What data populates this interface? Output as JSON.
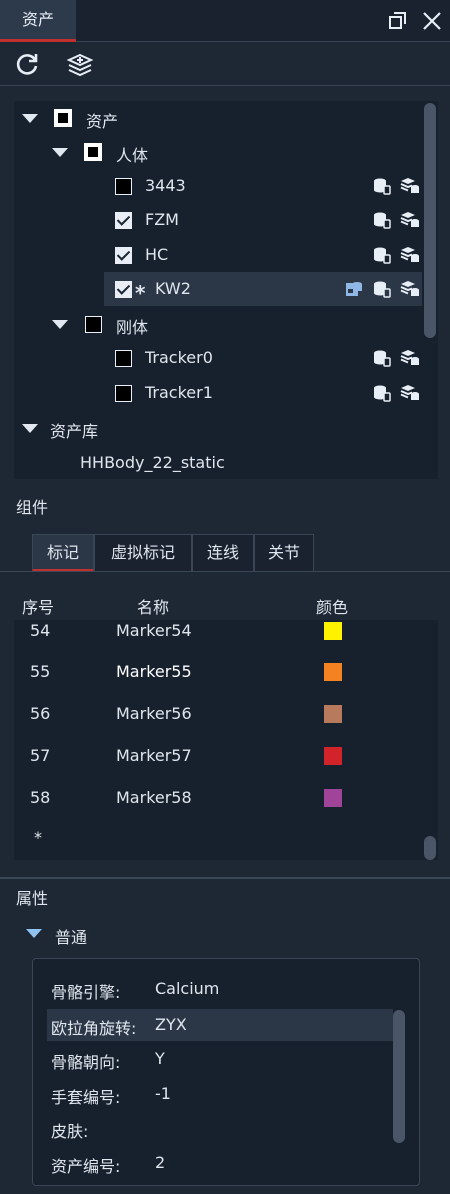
{
  "header": {
    "tab_label": "资产"
  },
  "tree": {
    "root": {
      "label": "资产"
    },
    "group_body": {
      "label": "人体"
    },
    "items": [
      {
        "label": "3443",
        "checked": false
      },
      {
        "label": "FZM",
        "checked": true
      },
      {
        "label": "HC",
        "checked": true
      },
      {
        "label": "KW2",
        "checked": true,
        "selected": true,
        "marker": "*"
      }
    ],
    "group_rigid": {
      "label": "刚体"
    },
    "rigid_items": [
      {
        "label": "Tracker0",
        "checked": false
      },
      {
        "label": "Tracker1",
        "checked": false
      }
    ],
    "library": {
      "label": "资产库",
      "item": "HHBody_22_static"
    }
  },
  "components": {
    "label": "组件",
    "tabs": [
      "标记",
      "虚拟标记",
      "连线",
      "关节"
    ],
    "active_tab": "标记",
    "columns": [
      "序号",
      "名称",
      "颜色"
    ],
    "rows": [
      {
        "num": "54",
        "name": "Marker54",
        "color": "#fff200"
      },
      {
        "num": "55",
        "name": "Marker55",
        "color": "#f58220"
      },
      {
        "num": "56",
        "name": "Marker56",
        "color": "#b87a5c"
      },
      {
        "num": "57",
        "name": "Marker57",
        "color": "#d2232a"
      },
      {
        "num": "58",
        "name": "Marker58",
        "color": "#a0449a"
      }
    ],
    "new_row_marker": "*"
  },
  "properties": {
    "label": "属性",
    "group": "普通",
    "rows": [
      {
        "key": "骨骼引擎:",
        "value": "Calcium"
      },
      {
        "key": "欧拉角旋转:",
        "value": "ZYX"
      },
      {
        "key": "骨骼朝向:",
        "value": "Y"
      },
      {
        "key": "手套编号:",
        "value": "-1"
      },
      {
        "key": "皮肤:",
        "value": ""
      },
      {
        "key": "资产编号:",
        "value": "2"
      }
    ]
  }
}
